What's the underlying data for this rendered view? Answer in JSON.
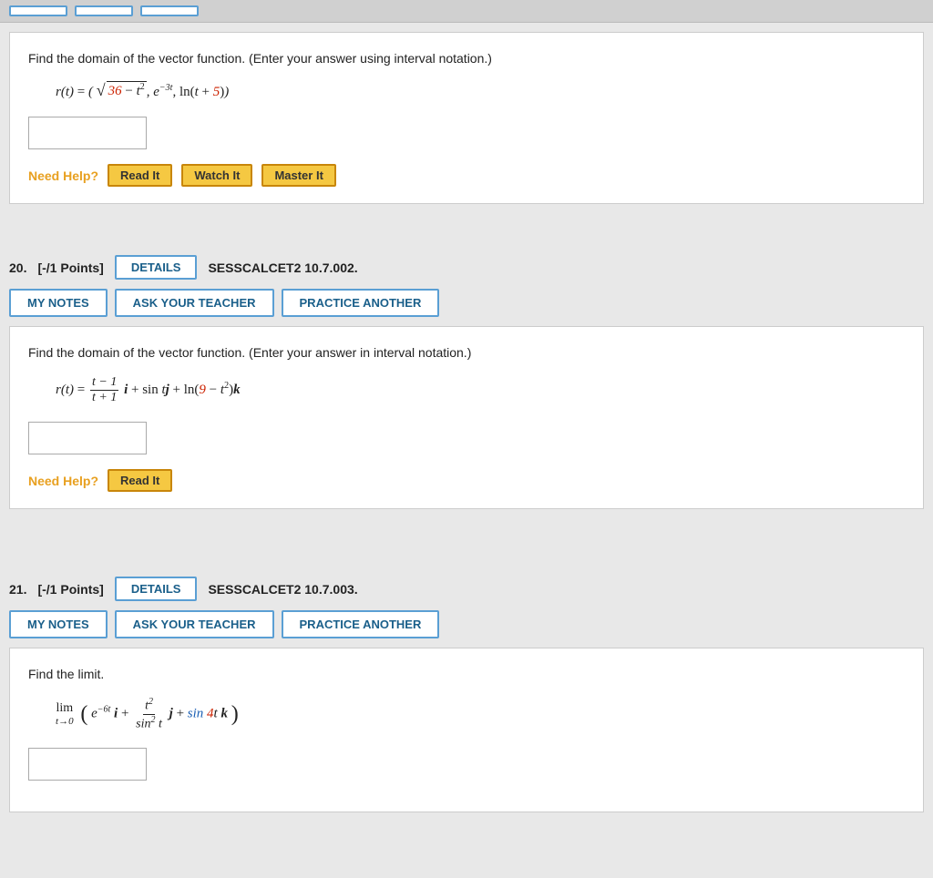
{
  "topBar": {
    "buttons": [
      "",
      "",
      ""
    ]
  },
  "questions": [
    {
      "number": "20.",
      "points": "[-/1 Points]",
      "detailsLabel": "DETAILS",
      "questionId": "SESSCALCET2 10.7.002.",
      "myNotesLabel": "MY NOTES",
      "askTeacherLabel": "ASK YOUR TEACHER",
      "practiceLabel": "PRACTICE ANOTHER",
      "problemText": "Find the domain of the vector function. (Enter your answer in interval notation.)",
      "needHelpLabel": "Need Help?",
      "helpButtons": [
        "Read It"
      ],
      "formula": "q20"
    },
    {
      "number": "21.",
      "points": "[-/1 Points]",
      "detailsLabel": "DETAILS",
      "questionId": "SESSCALCET2 10.7.003.",
      "myNotesLabel": "MY NOTES",
      "askTeacherLabel": "ASK YOUR TEACHER",
      "practiceLabel": "PRACTICE ANOTHER",
      "problemText": "Find the limit.",
      "needHelpLabel": "Need Help?",
      "helpButtons": [],
      "formula": "q21"
    }
  ],
  "topProblem": {
    "text": "Find the domain of the vector function. (Enter your answer using interval notation.)",
    "needHelpLabel": "Need Help?",
    "helpButtons": [
      "Read It",
      "Watch It",
      "Master It"
    ]
  }
}
